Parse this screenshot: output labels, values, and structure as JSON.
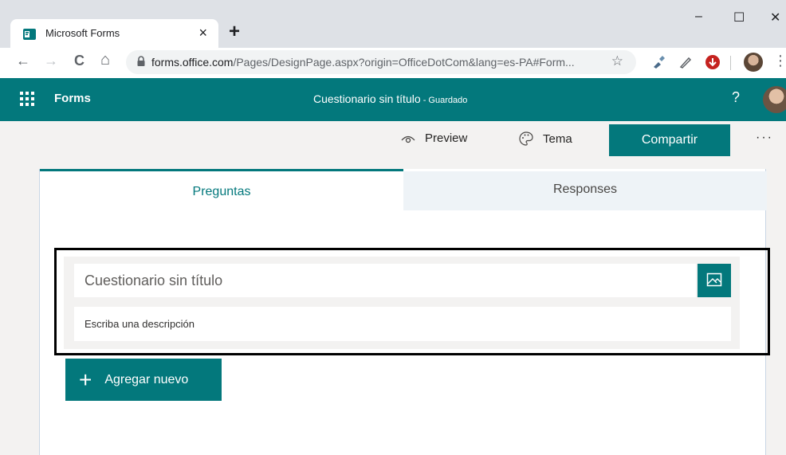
{
  "browser": {
    "tab_title": "Microsoft Forms",
    "tab_close": "×",
    "new_tab": "+",
    "window": {
      "minimize": "–",
      "maximize": "☐",
      "close": "✕"
    },
    "nav": {
      "back": "←",
      "forward": "→",
      "reload": "C",
      "home": "⌂"
    },
    "url_host": "forms.office.com",
    "url_path": "/Pages/DesignPage.aspx?origin=OfficeDotCom&lang=es-PA#Form...",
    "bookmark": "☆",
    "menu": "⋮"
  },
  "header": {
    "app_name": "Forms",
    "doc_title": "Cuestionario sin título",
    "doc_status": " - Guardado",
    "help": "?"
  },
  "commands": {
    "preview": "Preview",
    "theme": "Tema",
    "share": "Compartir",
    "more": "···"
  },
  "tabs": [
    {
      "label": "Preguntas",
      "active": true
    },
    {
      "label": "Responses",
      "active": false
    }
  ],
  "form": {
    "title_placeholder": "Cuestionario sin título",
    "description_placeholder": "Escriba una descripción",
    "add_new": "Agregar nuevo",
    "add_icon": "+"
  },
  "colors": {
    "accent": "#03787c",
    "background": "#f3f2f1"
  }
}
